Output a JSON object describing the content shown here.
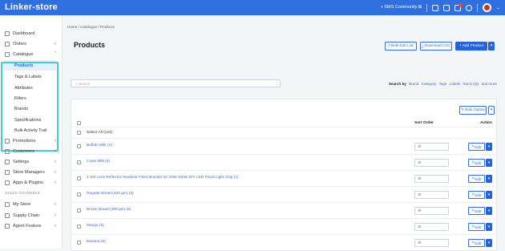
{
  "header": {
    "logo": "Linker-store",
    "community": "SMS Community",
    "colors": {
      "bar": "#2f6fe0",
      "accent": "#3fd0d4"
    }
  },
  "sidebar": {
    "items": [
      {
        "label": "Dashboard",
        "icon": "chart-icon"
      },
      {
        "label": "Orders",
        "icon": "orders-icon"
      },
      {
        "label": "Catalogue",
        "icon": "catalogue-icon"
      }
    ],
    "catalogue_sub": [
      "Products",
      "Tags & Labels",
      "Attributes",
      "Filters",
      "Brands",
      "Specifications",
      "Bulk Activity Trail"
    ],
    "items_after": [
      {
        "label": "Promotions",
        "icon": "promotions-icon"
      },
      {
        "label": "Customers",
        "icon": "customers-icon"
      },
      {
        "label": "Settings",
        "icon": "gear-icon"
      },
      {
        "label": "Store Managers",
        "icon": "managers-icon"
      },
      {
        "label": "Apps & Plugins",
        "icon": "apps-icon"
      }
    ],
    "section_label": "SALES CHANNELS",
    "channels": [
      {
        "label": "My Store",
        "icon": "store-icon"
      },
      {
        "label": "Supply Chain",
        "icon": "supply-icon"
      },
      {
        "label": "Agent Feature",
        "icon": "agent-icon"
      }
    ]
  },
  "main": {
    "breadcrumb": "Home / Catalogue / Products",
    "title": "Products",
    "buttons": {
      "bulk_edit": "Bulk Edit List",
      "download": "Download CSV",
      "add": "+ Add Product"
    },
    "search_placeholder": "Search",
    "search_by_label": "Search by",
    "search_by": [
      "Brand",
      "Category",
      "Tags",
      "Labels",
      "Stock Qty",
      "and more"
    ],
    "bulk_option": "Bulk Option",
    "col_sort": "Sort Order",
    "col_action": "Action",
    "select_all": "Select All (124)",
    "edit_label": "Edit",
    "rows": [
      {
        "name": "Buffalo Milk (4)",
        "sort": "0"
      },
      {
        "name": "Cows Milk (5)",
        "sort": "0"
      },
      {
        "name": "1 Set Lens Reflector Heatsink Fixed Bracket for 20W-100W DIY LED Flood Light Chip (1)",
        "sort": "0"
      },
      {
        "name": "Regular Bread (400 gm) (5)",
        "sort": "0"
      },
      {
        "name": "Brown Bread (400 gm) (5)",
        "sort": "0"
      },
      {
        "name": "Mango (5)",
        "sort": "0"
      },
      {
        "name": "Banana (5)",
        "sort": "0"
      }
    ]
  }
}
